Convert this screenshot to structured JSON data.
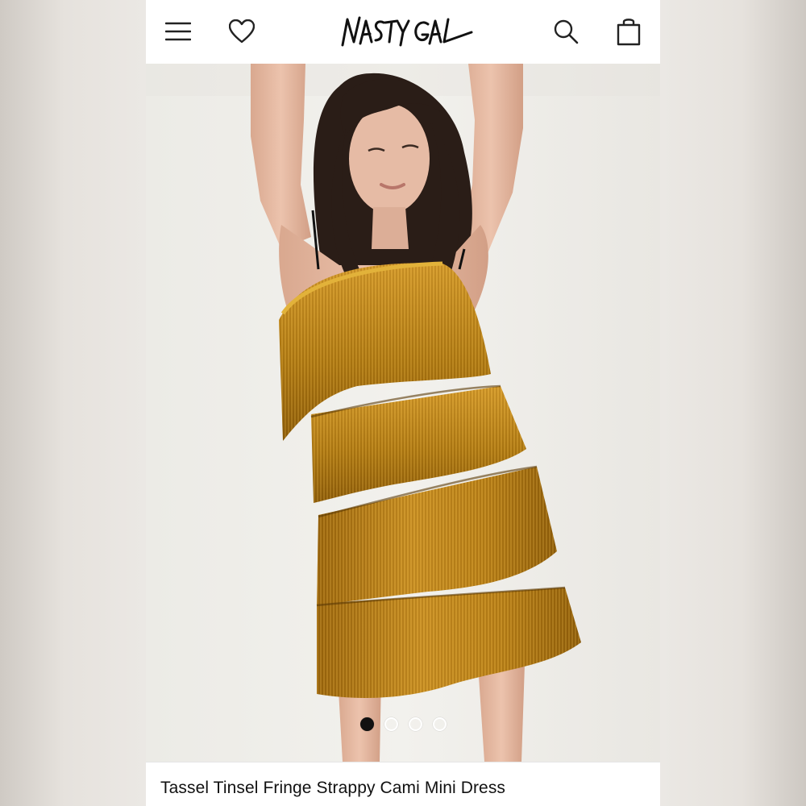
{
  "header": {
    "brand": "NASTY GAL",
    "menu_icon": "hamburger-menu-icon",
    "wishlist_icon": "heart-icon",
    "search_icon": "search-icon",
    "bag_icon": "shopping-bag-icon"
  },
  "gallery": {
    "total_slides": 4,
    "active_slide": 1
  },
  "product": {
    "title": "Tassel Tinsel Fringe Strappy Cami Mini Dress"
  },
  "colors": {
    "dress_gold": "#b07a12",
    "hair": "#2a1d17",
    "skin": "#e2b6a0",
    "active_dot": "#111111"
  }
}
